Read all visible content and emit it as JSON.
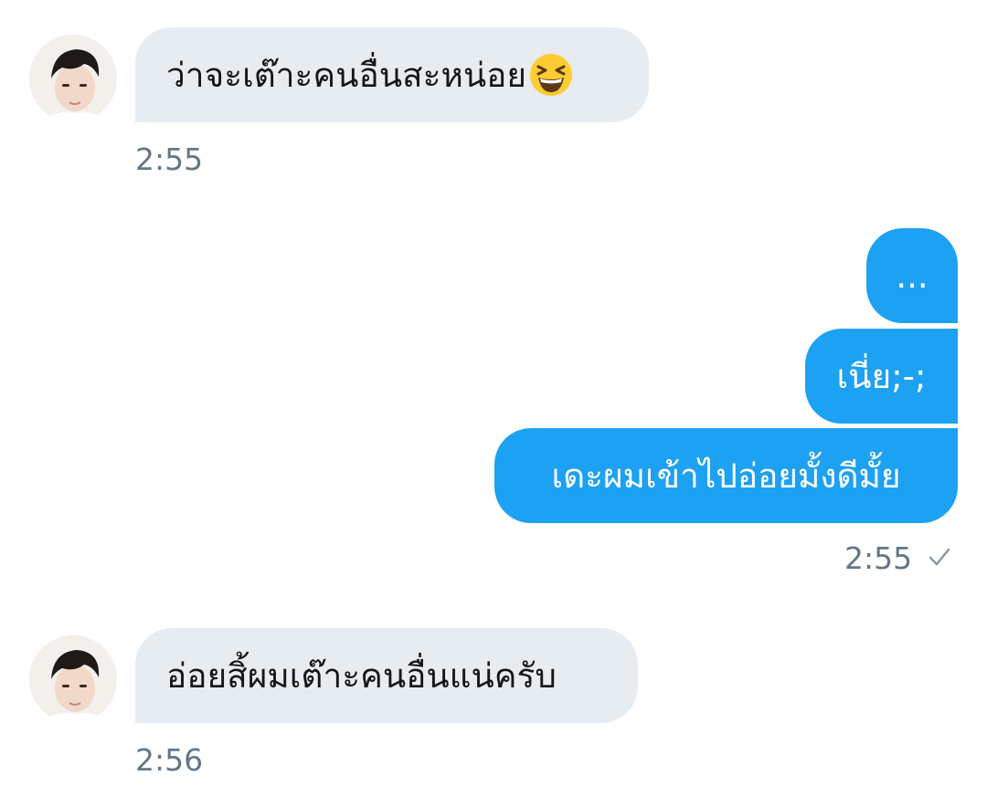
{
  "conversation": {
    "messages": [
      {
        "direction": "incoming",
        "text": "ว่าจะเต๊าะคนอื่นสะหน่อย",
        "emoji": "grinning-squinting-face",
        "time": "2:55"
      },
      {
        "direction": "outgoing",
        "group": [
          {
            "text": "..."
          },
          {
            "text": "เนี่ย;-;"
          },
          {
            "text": "เดะผมเข้าไปอ่อยมั้งดีมั้ย"
          }
        ],
        "time": "2:55",
        "status": "sent-check-icon"
      },
      {
        "direction": "incoming",
        "text": "อ่อยสิ้ผมเต๊าะคนอื่นแน่ครับ",
        "time": "2:56"
      }
    ]
  },
  "colors": {
    "incoming_bubble": "#e6ecf0",
    "outgoing_bubble": "#1da1f2",
    "timestamp": "#657786",
    "text_dark": "#14171a"
  }
}
